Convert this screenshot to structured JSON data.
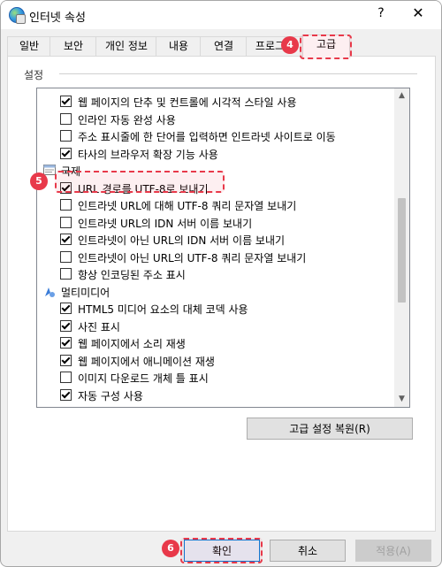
{
  "window": {
    "title": "인터넷 속성",
    "help": "?",
    "close": "✕"
  },
  "tabs": [
    "일반",
    "보안",
    "개인 정보",
    "내용",
    "연결",
    "프로그램",
    "고급"
  ],
  "active_tab": "고급",
  "group_label": "설정",
  "list": [
    {
      "type": "check",
      "checked": true,
      "label": "웹 페이지의 단추 및 컨트롤에 시각적 스타일 사용"
    },
    {
      "type": "check",
      "checked": false,
      "label": "인라인 자동 완성 사용"
    },
    {
      "type": "check",
      "checked": false,
      "label": "주소 표시줄에 한 단어를 입력하면 인트라넷 사이트로 이동"
    },
    {
      "type": "check",
      "checked": true,
      "label": "타사의 브라우저 확장 기능 사용"
    },
    {
      "type": "category",
      "icon": "globe-settings-icon",
      "label": "국제"
    },
    {
      "type": "check",
      "checked": true,
      "label": "URL 경로를 UTF-8로 보내기"
    },
    {
      "type": "check",
      "checked": false,
      "label": "인트라넷 URL에 대해 UTF-8 쿼리 문자열 보내기"
    },
    {
      "type": "check",
      "checked": false,
      "label": "인트라넷 URL의 IDN 서버 이름 보내기"
    },
    {
      "type": "check",
      "checked": true,
      "label": "인트라넷이 아닌 URL의 IDN 서버 이름 보내기"
    },
    {
      "type": "check",
      "checked": false,
      "label": "인트라넷이 아닌 URL의 UTF-8 쿼리 문자열 보내기"
    },
    {
      "type": "check",
      "checked": false,
      "label": "항상 인코딩된 주소 표시"
    },
    {
      "type": "category",
      "icon": "multimedia-icon",
      "label": "멀티미디어"
    },
    {
      "type": "check",
      "checked": true,
      "label": "HTML5 미디어 요소의 대체 코덱 사용"
    },
    {
      "type": "check",
      "checked": true,
      "label": "사진 표시"
    },
    {
      "type": "check",
      "checked": true,
      "label": "웹 페이지에서 소리 재생"
    },
    {
      "type": "check",
      "checked": true,
      "label": "웹 페이지에서 애니메이션 재생"
    },
    {
      "type": "check",
      "checked": false,
      "label": "이미지 다운로드 개체 틀 표시"
    },
    {
      "type": "check",
      "checked": true,
      "label": "자동 구성 사용"
    }
  ],
  "restore_button": "고급 설정 복원(R)",
  "buttons": {
    "ok": "확인",
    "cancel": "취소",
    "apply": "적용(A)"
  },
  "annotations": {
    "tab_step": "4",
    "option_step": "5",
    "ok_step": "6"
  },
  "colors": {
    "annotation": "#e8394a",
    "accent": "#0078d7"
  }
}
